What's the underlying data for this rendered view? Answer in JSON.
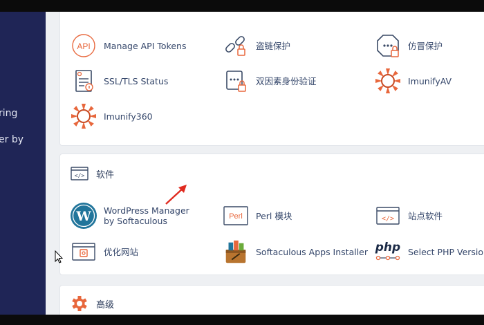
{
  "sidebar": {
    "fragments": [
      "ring",
      "er by"
    ]
  },
  "security": {
    "items": [
      {
        "label": "Manage API Tokens",
        "icon": "api-icon"
      },
      {
        "label": "盗链保护",
        "icon": "hotlink-protection-icon"
      },
      {
        "label": "仿冒保护",
        "icon": "spoof-protection-icon"
      },
      {
        "label": "SSL/TLS Status",
        "icon": "ssl-status-icon"
      },
      {
        "label": "双因素身份验证",
        "icon": "two-factor-auth-icon"
      },
      {
        "label": "ImunifyAV",
        "icon": "imunifyav-icon"
      },
      {
        "label": "Imunify360",
        "icon": "imunify360-icon"
      }
    ]
  },
  "software": {
    "title": "软件",
    "items": [
      {
        "label": "WordPress Manager by Softaculous",
        "icon": "wordpress-icon"
      },
      {
        "label": "Perl 模块",
        "icon": "perl-modules-icon"
      },
      {
        "label": "站点软件",
        "icon": "site-software-icon"
      },
      {
        "label": "优化网站",
        "icon": "optimize-website-icon"
      },
      {
        "label": "Softaculous Apps Installer",
        "icon": "softaculous-icon"
      },
      {
        "label": "Select PHP Version",
        "icon": "php-icon"
      }
    ]
  },
  "advanced": {
    "title": "高级"
  },
  "colors": {
    "sidebar": "#1f2556",
    "accent": "#e8673c",
    "text": "#34466a",
    "wordpress": "#21759b"
  }
}
